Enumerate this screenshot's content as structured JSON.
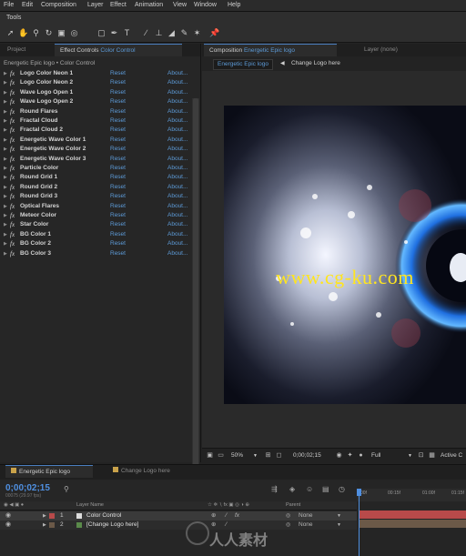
{
  "menu": [
    "File",
    "Edit",
    "Composition",
    "Layer",
    "Effect",
    "Animation",
    "View",
    "Window",
    "Help"
  ],
  "tools": {
    "title": "Tools",
    "icons": [
      "selection-tool-icon",
      "hand-tool-icon",
      "zoom-tool-icon",
      "rotate-tool-icon",
      "camera-tool-icon",
      "pan-behind-tool-icon",
      "mask-tool-icon",
      "pen-tool-icon",
      "type-tool-icon",
      "brush-tool-icon",
      "clone-stamp-tool-icon",
      "eraser-tool-icon",
      "roto-brush-tool-icon",
      "puppet-tool-icon"
    ]
  },
  "left_panel": {
    "tabs": {
      "project": "Project",
      "effect_controls_prefix": "Effect Controls",
      "effect_controls_layer": "Color Control"
    },
    "header": "Energetic Epic logo • Color Control",
    "reset_label": "Reset",
    "about_label": "About...",
    "effects": [
      "Logo Color Neon 1",
      "Logo Color Neon 2",
      "Wave Logo Open 1",
      "Wave Logo Open 2",
      "Round Flares",
      "Fractal Cloud",
      "Fractal Cloud 2",
      "Energetic Wave Color 1",
      "Energetic Wave Color 2",
      "Energetic Wave Color 3",
      "Particle Color",
      "Round Grid 1",
      "Round Grid 2",
      "Round Grid 3",
      "Optical Flares",
      "Meteor Color",
      "Star Color",
      "BG Color 1",
      "BG Color 2",
      "BG Color 3"
    ]
  },
  "comp_panel": {
    "tab_prefix": "Composition",
    "tab_comp": "Energetic Epic logo",
    "layer_tab": "Layer (none)",
    "nav_active": "Energetic Epic logo",
    "nav_other": "Change Logo here",
    "watermark": "www.cg-ku.com",
    "zoom": "50%",
    "timecode": "0;00;02;15",
    "resolution": "Full",
    "active_camera": "Active C"
  },
  "timeline": {
    "tab1": "Energetic Epic logo",
    "tab2": "Change Logo here",
    "timecode": "0;00;02;15",
    "fps": "00075 (29.97 fps)",
    "headers": {
      "layer_name": "Layer Name",
      "parent": "Parent"
    },
    "layers": [
      {
        "num": "1",
        "name": "Color Control",
        "parent": "None",
        "color": "#b84a4a"
      },
      {
        "num": "2",
        "name": "[Change Logo here]",
        "parent": "None",
        "color": "#6b5948"
      }
    ],
    "ruler": [
      "00f",
      "00:15f",
      "01:00f",
      "01:15f"
    ]
  },
  "watermark_cn": "人人素材"
}
